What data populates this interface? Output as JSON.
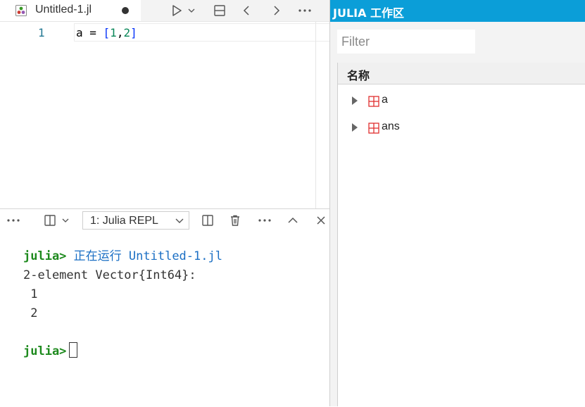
{
  "editor": {
    "tab_label": "Untitled-1.jl",
    "line_number": "1",
    "code": {
      "lhs": "a = ",
      "open": "[",
      "n1": "1",
      "comma": ",",
      "n2": "2",
      "close": "]"
    },
    "toolbar_icons": [
      "run-icon",
      "chevron-down-icon",
      "split-editor-icon",
      "back-icon",
      "forward-icon",
      "more-icon"
    ]
  },
  "panel": {
    "terminal_select": "1: Julia REPL",
    "lines": {
      "prompt1": "julia>",
      "running": "正在运行 Untitled-1.jl",
      "out1": "2-element Vector{Int64}:",
      "out2": " 1",
      "out3": " 2",
      "prompt2": "julia>"
    }
  },
  "workspace": {
    "title": "JULIA 工作区",
    "filter_placeholder": "Filter",
    "column_name": "名称",
    "variables": [
      {
        "name": "a"
      },
      {
        "name": "ans"
      }
    ]
  },
  "colors": {
    "accent": "#0b9ed8",
    "prompt": "#1e8a1e",
    "running_text": "#1b6fc4",
    "array_icon": "#e03030"
  }
}
